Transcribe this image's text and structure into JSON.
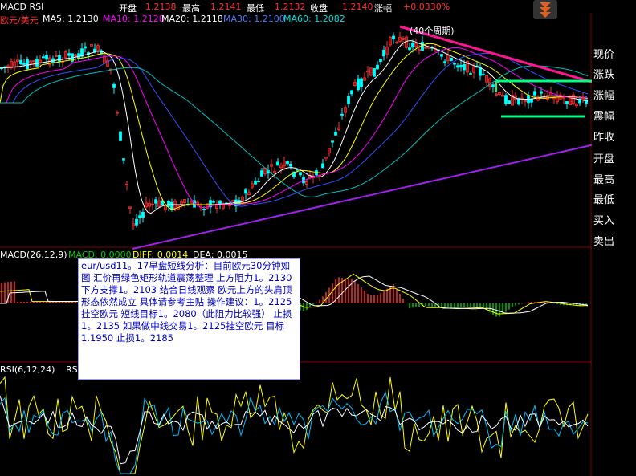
{
  "header": {
    "tab": "MACD RSI",
    "open_label": "开盘",
    "open_value": "1.2138",
    "high_label": "最高",
    "high_value": "1.2141",
    "low_label": "最低",
    "low_value": "1.2132",
    "close_label": "收盘",
    "close_value": "1.2140",
    "change_label": "涨幅",
    "change_value": "+0.0330%"
  },
  "main_chart": {
    "symbol": "欧元/美元",
    "ma5": "MA5: 1.2130",
    "ma10": "MA10: 1.2128",
    "ma20": "MA20: 1.2118",
    "ma30": "MA30: 1.2100",
    "ma60": "MA60: 1.2082",
    "annotation": "(40个周期)"
  },
  "macd_panel": {
    "title": "MACD(26,12,9)",
    "macd": "MACD: 0.0000",
    "diff": "DIFF: 0.0014",
    "dea": "DEA: 0.0015"
  },
  "rsi_panel": {
    "title": "RSI(6,12,24)",
    "rsi1": "RSI1"
  },
  "sidebar": {
    "items": [
      "现价",
      "涨跌",
      "涨幅",
      "震幅",
      "昨收",
      "开盘",
      "最高",
      "最低",
      "买入",
      "卖出"
    ]
  },
  "analysis_text": "eur/usd11。17早盘短线分析：目前欧元30分钟如图 汇价再绿色矩形轨道震荡整理 上方阻力1。2130 下方支撑1。2103 结合日线观察 欧元上方的头肩顶形态依然成立 具体请参考主贴 操作建议：1。2125挂空欧元 短线目标1。2080（此阻力比较强） 止损1。2135 如果做中线交易1。2125挂空欧元 目标1.1950 止损1。2185",
  "colors": {
    "up_candle": "#ff3030",
    "down_candle": "#00ffff",
    "resistance_line": "#ff1493",
    "support_line": "#a020f0",
    "channel_lines": "#00ff7f"
  }
}
